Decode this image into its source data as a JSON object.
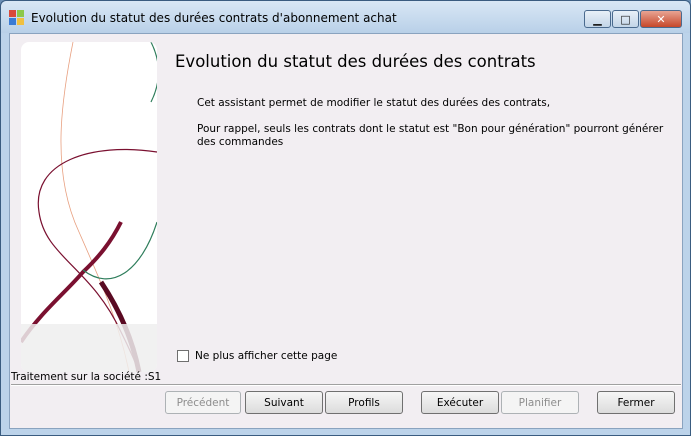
{
  "window": {
    "title": "Evolution du statut des durées contrats d'abonnement achat",
    "controls": {
      "minimize": "▁",
      "maximize": "□",
      "close": "✕"
    }
  },
  "wizard": {
    "heading": "Evolution du statut des durées des contrats",
    "paragraph1": "Cet assistant permet de modifier le statut des durées des contrats,",
    "paragraph2": "Pour rappel, seuls les contrats dont le statut est \"Bon pour génération\" pourront générer des commandes",
    "dont_show_label": "Ne plus afficher cette page",
    "dont_show_checked": false,
    "status": "Traitement sur la société :S1"
  },
  "buttons": {
    "previous": "Précédent",
    "next": "Suivant",
    "profiles": "Profils",
    "execute": "Exécuter",
    "plan": "Planifier",
    "close": "Fermer"
  },
  "colors": {
    "client_bg": "#f2eef2",
    "titlebar": "#c8dbee",
    "close_button": "#c6472a",
    "decor_wine": "#7a1030",
    "decor_green": "#2e7d5b",
    "decor_peach": "#e8a080"
  }
}
